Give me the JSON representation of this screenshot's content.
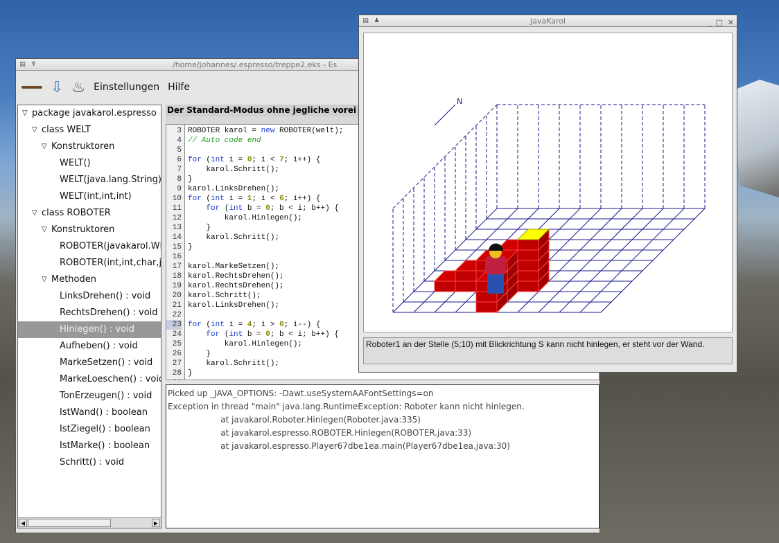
{
  "main_window": {
    "title": "/home/johannes/.espresso/treppe2.eks - Es",
    "toolbar": {
      "icons": [
        "broom-icon",
        "save-icon",
        "run-espresso-icon"
      ],
      "menu": [
        "Einstellungen",
        "Hilfe"
      ]
    },
    "tree": [
      {
        "label": "package javakarol.espresso",
        "level": 0,
        "expander": true
      },
      {
        "label": "class WELT",
        "level": 1,
        "expander": true
      },
      {
        "label": "Konstruktoren",
        "level": 2,
        "expander": true
      },
      {
        "label": "WELT()",
        "level": 3
      },
      {
        "label": "WELT(java.lang.String)",
        "level": 3
      },
      {
        "label": "WELT(int,int,int)",
        "level": 3
      },
      {
        "label": "class ROBOTER",
        "level": 1,
        "expander": true
      },
      {
        "label": "Konstruktoren",
        "level": 2,
        "expander": true
      },
      {
        "label": "ROBOTER(javakarol.WELT)",
        "level": 3
      },
      {
        "label": "ROBOTER(int,int,char,javakarol.WELT)",
        "level": 3
      },
      {
        "label": "Methoden",
        "level": 2,
        "expander": true
      },
      {
        "label": "LinksDrehen() : void",
        "level": 3
      },
      {
        "label": "RechtsDrehen() : void",
        "level": 3
      },
      {
        "label": "Hinlegen() : void",
        "level": 3,
        "selected": true
      },
      {
        "label": "Aufheben() : void",
        "level": 3
      },
      {
        "label": "MarkeSetzen() : void",
        "level": 3
      },
      {
        "label": "MarkeLoeschen() : void",
        "level": 3
      },
      {
        "label": "TonErzeugen() : void",
        "level": 3
      },
      {
        "label": "IstWand() : boolean",
        "level": 3
      },
      {
        "label": "IstZiegel() : boolean",
        "level": 3
      },
      {
        "label": "IstMarke() : boolean",
        "level": 3
      },
      {
        "label": "Schritt() : void",
        "level": 3
      }
    ],
    "editor_header": "Der Standard-Modus ohne jegliche vorei",
    "code": [
      {
        "n": "3",
        "t": "ROBOTER karol = [k]new[/k] ROBOTER(welt);"
      },
      {
        "n": "4",
        "t": "[c]// Auto code end[/c]"
      },
      {
        "n": "5",
        "t": ""
      },
      {
        "n": "6",
        "t": "[k]for[/k] ([k]int[/k] i = [n]0[/n]; i < [n]7[/n]; i++) {"
      },
      {
        "n": "7",
        "t": "    karol.Schritt();"
      },
      {
        "n": "8",
        "t": "}"
      },
      {
        "n": "9",
        "t": "karol.LinksDrehen();"
      },
      {
        "n": "10",
        "t": "[k]for[/k] ([k]int[/k] i = [n]1[/n]; i < [n]6[/n]; i++) {"
      },
      {
        "n": "11",
        "t": "    [k]for[/k] ([k]int[/k] b = [n]0[/n]; b < i; b++) {"
      },
      {
        "n": "12",
        "t": "        karol.Hinlegen();"
      },
      {
        "n": "13",
        "t": "    }"
      },
      {
        "n": "14",
        "t": "    karol.Schritt();"
      },
      {
        "n": "15",
        "t": "}"
      },
      {
        "n": "16",
        "t": ""
      },
      {
        "n": "17",
        "t": "karol.MarkeSetzen();"
      },
      {
        "n": "18",
        "t": "karol.RechtsDrehen();"
      },
      {
        "n": "19",
        "t": "karol.RechtsDrehen();"
      },
      {
        "n": "20",
        "t": "karol.Schritt();"
      },
      {
        "n": "21",
        "t": "karol.LinksDrehen();"
      },
      {
        "n": "22",
        "t": ""
      },
      {
        "n": "23",
        "t": "[k]for[/k] ([k]int[/k] i = [n]4[/n]; i > [n]0[/n]; i--) {"
      },
      {
        "n": "24",
        "t": "    [k]for[/k] ([k]int[/k] b = [n]0[/n]; b < i; b++) {"
      },
      {
        "n": "25",
        "t": "        karol.Hinlegen();"
      },
      {
        "n": "26",
        "t": "    }"
      },
      {
        "n": "27",
        "t": "    karol.Schritt();"
      },
      {
        "n": "28",
        "t": "}"
      },
      {
        "n": "29",
        "t": ""
      }
    ],
    "console": [
      "Picked up _JAVA_OPTIONS: -Dawt.useSystemAAFontSettings=on",
      "Exception in thread \"main\" java.lang.RuntimeException: Roboter kann nicht hinlegen.",
      "                    at javakarol.Roboter.Hinlegen(Roboter.java:335)",
      "                    at javakarol.espresso.ROBOTER.Hinlegen(ROBOTER.java:33)",
      "                    at javakarol.espresso.Player67dbe1ea.main(Player67dbe1ea.java:30)"
    ]
  },
  "karol_window": {
    "title": "JavaKarol",
    "compass": "N",
    "status": "Roboter1 an der Stelle (5;10) mit Blickrichtung S kann nicht hinlegen, er steht vor der Wand.",
    "colors": {
      "grid": "#1a1a8c",
      "brick": "#c00000",
      "mark": "#ffff00"
    }
  }
}
